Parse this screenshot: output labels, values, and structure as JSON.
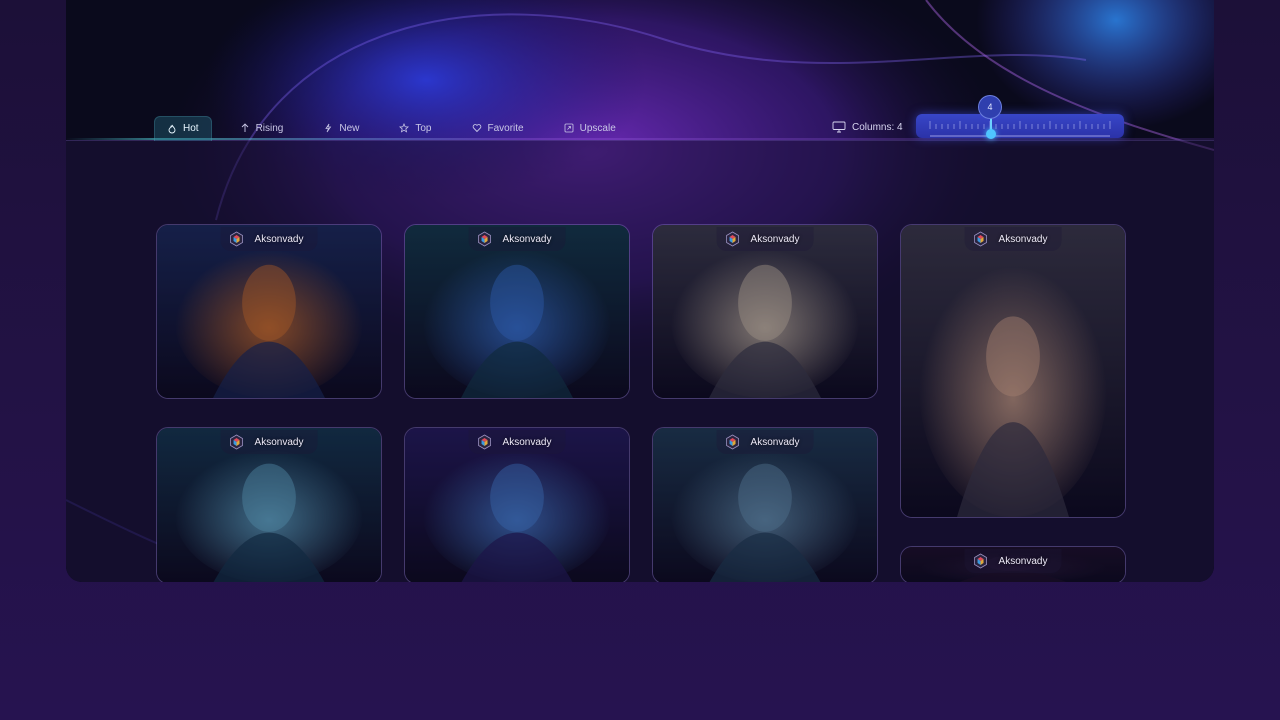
{
  "filters": [
    {
      "label": "Hot",
      "icon": "flame-icon"
    },
    {
      "label": "Rising",
      "icon": "arrow-up-icon"
    },
    {
      "label": "New",
      "icon": "sparkle-icon"
    },
    {
      "label": "Top",
      "icon": "star-icon"
    },
    {
      "label": "Favorite",
      "icon": "heart-icon"
    },
    {
      "label": "Upscale",
      "icon": "upscale-icon"
    }
  ],
  "active_filter": "Hot",
  "columns": {
    "label": "Columns: 4",
    "icon": "monitor-icon",
    "slider_value": "4",
    "slider_fraction": 0.3
  },
  "cards": [
    {
      "author": "Aksonvady",
      "theme": "horned sorceress with fire orb",
      "palette": [
        "#1a2a5a",
        "#e0782a"
      ]
    },
    {
      "author": "Aksonvady",
      "theme": "armored knight walking",
      "palette": [
        "#12384a",
        "#3a7ae0"
      ]
    },
    {
      "author": "Aksonvady",
      "theme": "elf queen with dragon under moon",
      "palette": [
        "#3a3a4a",
        "#d8c8b0"
      ]
    },
    {
      "author": "Aksonvady",
      "theme": "demon woman with horns",
      "palette": [
        "#3a3848",
        "#e0b090"
      ]
    },
    {
      "author": "Aksonvady",
      "theme": "pale spirit woman",
      "palette": [
        "#14364e",
        "#6ab8d8"
      ]
    },
    {
      "author": "Aksonvady",
      "theme": "blue elf warrior",
      "palette": [
        "#231a5a",
        "#4a8ae0"
      ]
    },
    {
      "author": "Aksonvady",
      "theme": "hooded cloaked figure",
      "palette": [
        "#1e3a52",
        "#6a9ab8"
      ]
    },
    {
      "author": "Aksonvady",
      "theme": "dark art",
      "palette": [
        "#1c1028",
        "#2c1a3a"
      ]
    }
  ],
  "colors": {
    "accent": "#4fc5ff",
    "slider": "#3846c8",
    "text": "#c9c7e6"
  }
}
